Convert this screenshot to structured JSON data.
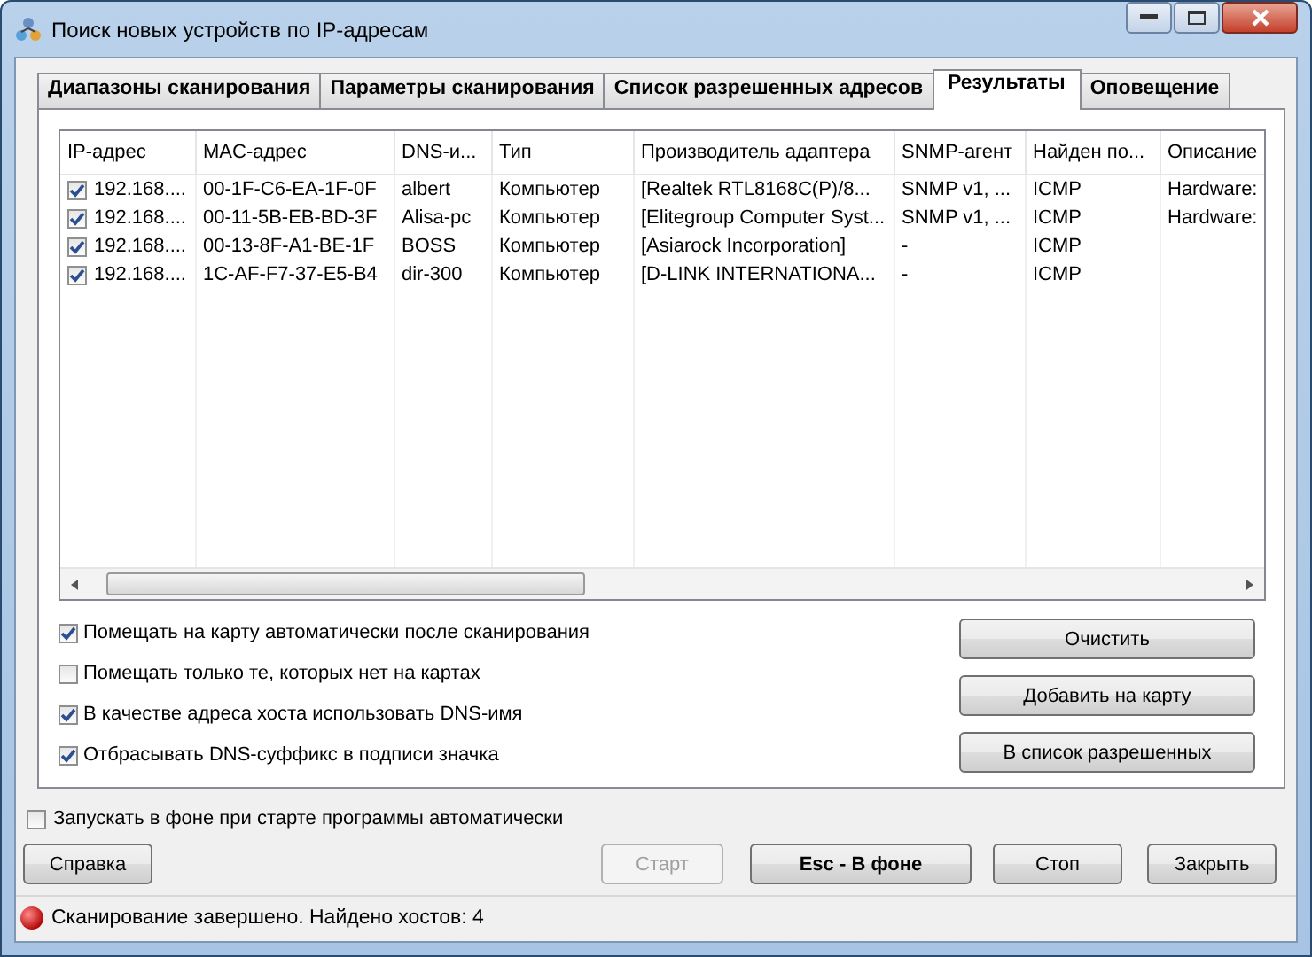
{
  "window": {
    "title": "Поиск новых устройств по IP-адресам"
  },
  "tabs": [
    {
      "label": "Диапазоны сканирования",
      "selected": false
    },
    {
      "label": "Параметры сканирования",
      "selected": false
    },
    {
      "label": "Список разрешенных адресов",
      "selected": false
    },
    {
      "label": "Результаты",
      "selected": true
    },
    {
      "label": "Оповещение",
      "selected": false
    }
  ],
  "table": {
    "columns": [
      "IP-адрес",
      "MAC-адрес",
      "DNS-и...",
      "Тип",
      "Производитель адаптера",
      "SNMP-агент",
      "Найден по...",
      "Описание"
    ],
    "rows": [
      {
        "checked": true,
        "cells": [
          "192.168....",
          "00-1F-C6-EA-1F-0F",
          "albert",
          "Компьютер",
          "[Realtek RTL8168C(P)/8...",
          "SNMP v1, ...",
          "ICMP",
          "Hardware:"
        ]
      },
      {
        "checked": true,
        "cells": [
          "192.168....",
          "00-11-5B-EB-BD-3F",
          "Alisa-pc",
          "Компьютер",
          "[Elitegroup Computer Syst...",
          "SNMP v1, ...",
          "ICMP",
          "Hardware:"
        ]
      },
      {
        "checked": true,
        "cells": [
          "192.168....",
          "00-13-8F-A1-BE-1F",
          "BOSS",
          "Компьютер",
          "[Asiarock Incorporation]",
          "-",
          "ICMP",
          ""
        ]
      },
      {
        "checked": true,
        "cells": [
          "192.168....",
          "1C-AF-F7-37-E5-B4",
          "dir-300",
          "Компьютер",
          "[D-LINK INTERNATIONA...",
          "-",
          "ICMP",
          ""
        ]
      }
    ]
  },
  "options": [
    {
      "label": "Помещать на карту автоматически после сканирования",
      "checked": true
    },
    {
      "label": "Помещать только те, которых нет на картах",
      "checked": false
    },
    {
      "label": "В качестве адреса хоста использовать DNS-имя",
      "checked": true
    },
    {
      "label": "Отбрасывать DNS-суффикс в подписи значка",
      "checked": true
    }
  ],
  "side_buttons": [
    "Очистить",
    "Добавить на карту",
    "В список разрешенных"
  ],
  "background_option": {
    "label": "Запускать в фоне при старте программы автоматически",
    "checked": false
  },
  "buttons": [
    {
      "label": "Справка",
      "disabled": false,
      "bold": false
    },
    {
      "label": "Старт",
      "disabled": true,
      "bold": false
    },
    {
      "label": "Esc - В фоне",
      "disabled": false,
      "bold": true
    },
    {
      "label": "Стоп",
      "disabled": false,
      "bold": false
    },
    {
      "label": "Закрыть",
      "disabled": false,
      "bold": false
    }
  ],
  "status_bar": {
    "text": "Сканирование завершено. Найдено хостов: 4"
  }
}
